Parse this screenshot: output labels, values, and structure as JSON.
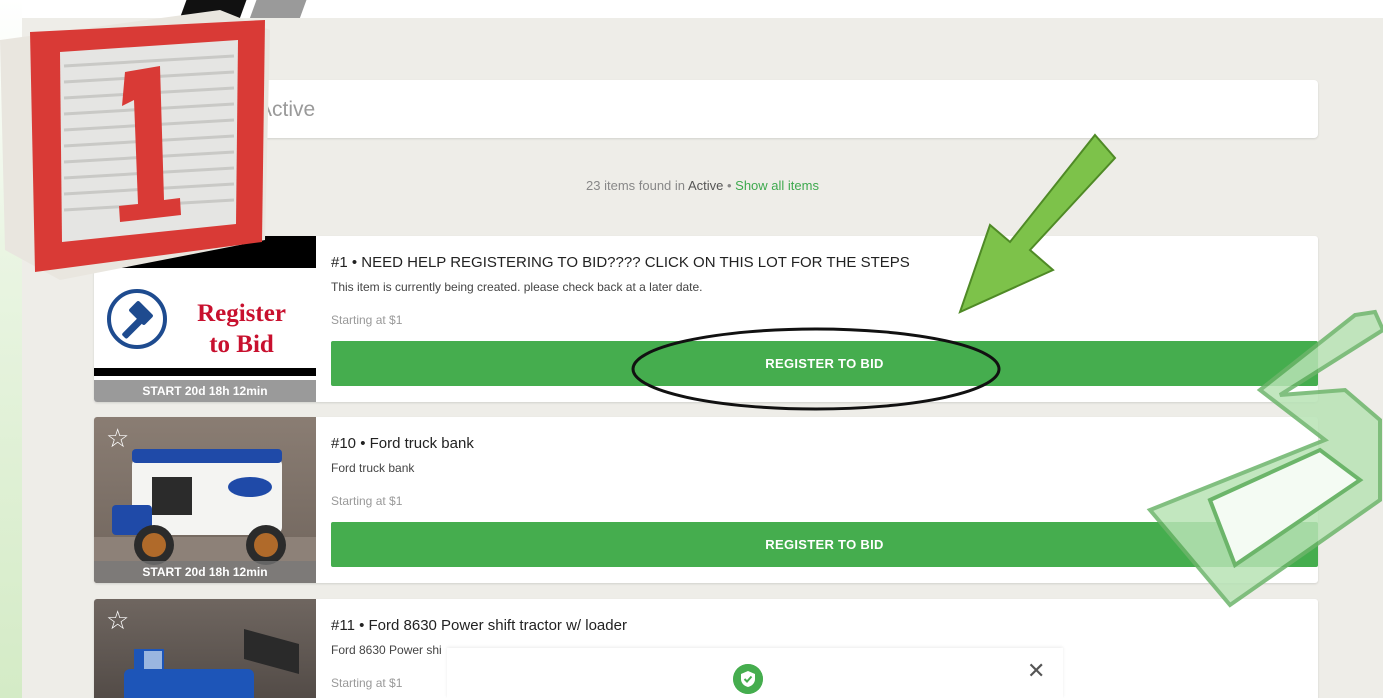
{
  "search": {
    "value": "Active"
  },
  "results": {
    "count_text": "23 items found in",
    "filter": "Active",
    "separator": "•",
    "show_all": "Show all items"
  },
  "lots": [
    {
      "title": "#1 • NEED HELP REGISTERING TO BID???? CLICK ON THIS LOT FOR THE STEPS",
      "description": "This item is currently being created. please check back at a later date.",
      "starting": "Starting at $1",
      "button": "REGISTER TO BID",
      "badge": "START 20d 18h 12min",
      "thumb_text_1": "Register",
      "thumb_text_2": "to Bid"
    },
    {
      "title": "#10 • Ford truck bank",
      "description": "Ford truck bank",
      "starting": "Starting at $1",
      "button": "REGISTER TO BID",
      "badge": "START 20d 18h 12min"
    },
    {
      "title": "#11 • Ford 8630 Power shift tractor w/ loader",
      "description": "Ford 8630 Power shi",
      "starting": "Starting at $1"
    }
  ],
  "icons": {
    "favorite": "star-outline-icon",
    "toast": "check-shield-icon",
    "close": "close-icon"
  },
  "colors": {
    "accent": "#45ad4e",
    "register_red": "#c8102e",
    "page_bg": "#eeede8"
  },
  "block_numeral": "1"
}
